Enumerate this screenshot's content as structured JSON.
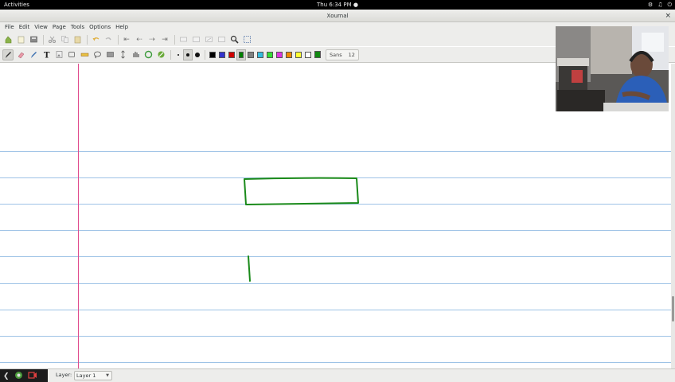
{
  "topbar": {
    "activities": "Activities",
    "clock": "Thu  6:34 PM ●",
    "icons": [
      "accessibility-icon",
      "volume-icon",
      "power-icon"
    ]
  },
  "window": {
    "title": "Xournal",
    "close": "×"
  },
  "menu": [
    "File",
    "Edit",
    "View",
    "Page",
    "Tools",
    "Options",
    "Help"
  ],
  "toolbar1": [
    "new-icon",
    "open-icon",
    "save-icon",
    "cut-icon",
    "copy-icon",
    "paste-icon",
    "undo-icon",
    "redo-icon",
    "first-page-icon",
    "previous-page-icon",
    "next-page-icon",
    "last-page-icon",
    "zoom-out-icon",
    "zoom-normal-icon",
    "zoom-in-icon",
    "page-width-icon",
    "find-icon",
    "fullscreen-icon"
  ],
  "toolbar2": {
    "tools": [
      "pen-icon",
      "eraser-icon",
      "highlighter-icon",
      "text-icon",
      "image-icon",
      "shape-recognizer-icon",
      "ruler-icon",
      "lasso-select-icon",
      "rect-select-icon",
      "vertical-space-icon",
      "hand-icon",
      "default-pen-icon",
      "default-highlighter-icon"
    ],
    "thickness": [
      "thin",
      "medium",
      "thick"
    ],
    "colors": [
      "#000000",
      "#3333cc",
      "#d00000",
      "#008000",
      "#808080",
      "#33bbdd",
      "#33dd33",
      "#dd33dd",
      "#ee8800",
      "#ffff33",
      "#ffffff"
    ],
    "current_color": "#118811",
    "font_name": "Sans",
    "font_size": "12"
  },
  "page": {
    "ink_color": "#1a8a1a",
    "rule_color": "#9ec3e6",
    "margin_color": "#e04a8c"
  },
  "status": {
    "layer_label": "Layer:",
    "layer_value": "Layer 1"
  }
}
